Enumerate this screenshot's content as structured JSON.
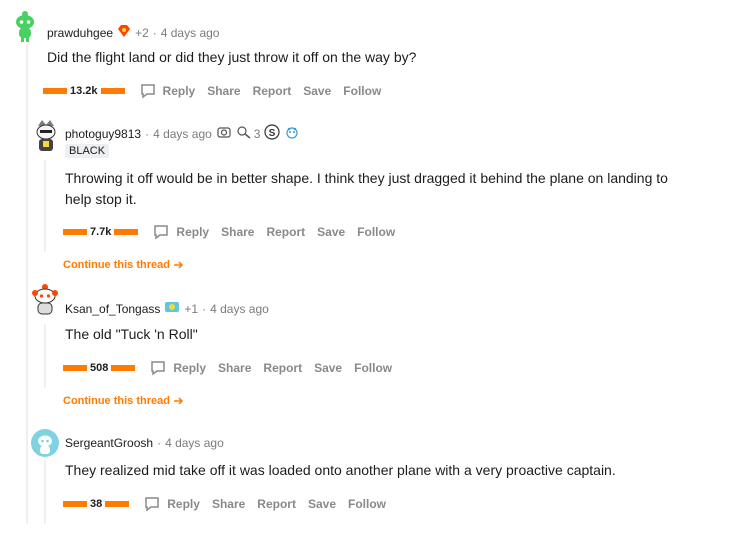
{
  "comments": [
    {
      "username": "prawduhgee",
      "karma": "+2",
      "time": "4 days ago",
      "body": "Did the flight land or did they just throw it off on the way by?",
      "votes": "13.2k",
      "avatar_color": "#46d160"
    },
    {
      "username": "photoguy9813",
      "time": "4 days ago",
      "award_count": "3",
      "flair": "BLACK",
      "body": "Throwing it off would be in better shape. I think they just dragged it behind the plane on landing to help stop it.",
      "votes": "7.7k"
    },
    {
      "username": "Ksan_of_Tongass",
      "karma": "+1",
      "time": "4 days ago",
      "body": "The old \"Tuck 'n Roll\"",
      "votes": "508"
    },
    {
      "username": "SergeantGroosh",
      "time": "4 days ago",
      "body": "They realized mid take off it was loaded onto another plane with a very proactive captain.",
      "votes": "38",
      "avatar_color": "#7fd3e0"
    }
  ],
  "actions": {
    "reply": "Reply",
    "share": "Share",
    "report": "Report",
    "save": "Save",
    "follow": "Follow"
  },
  "continue_thread": "Continue this thread",
  "colors": {
    "accent": "#ff7a00",
    "muted": "#878a8c"
  }
}
